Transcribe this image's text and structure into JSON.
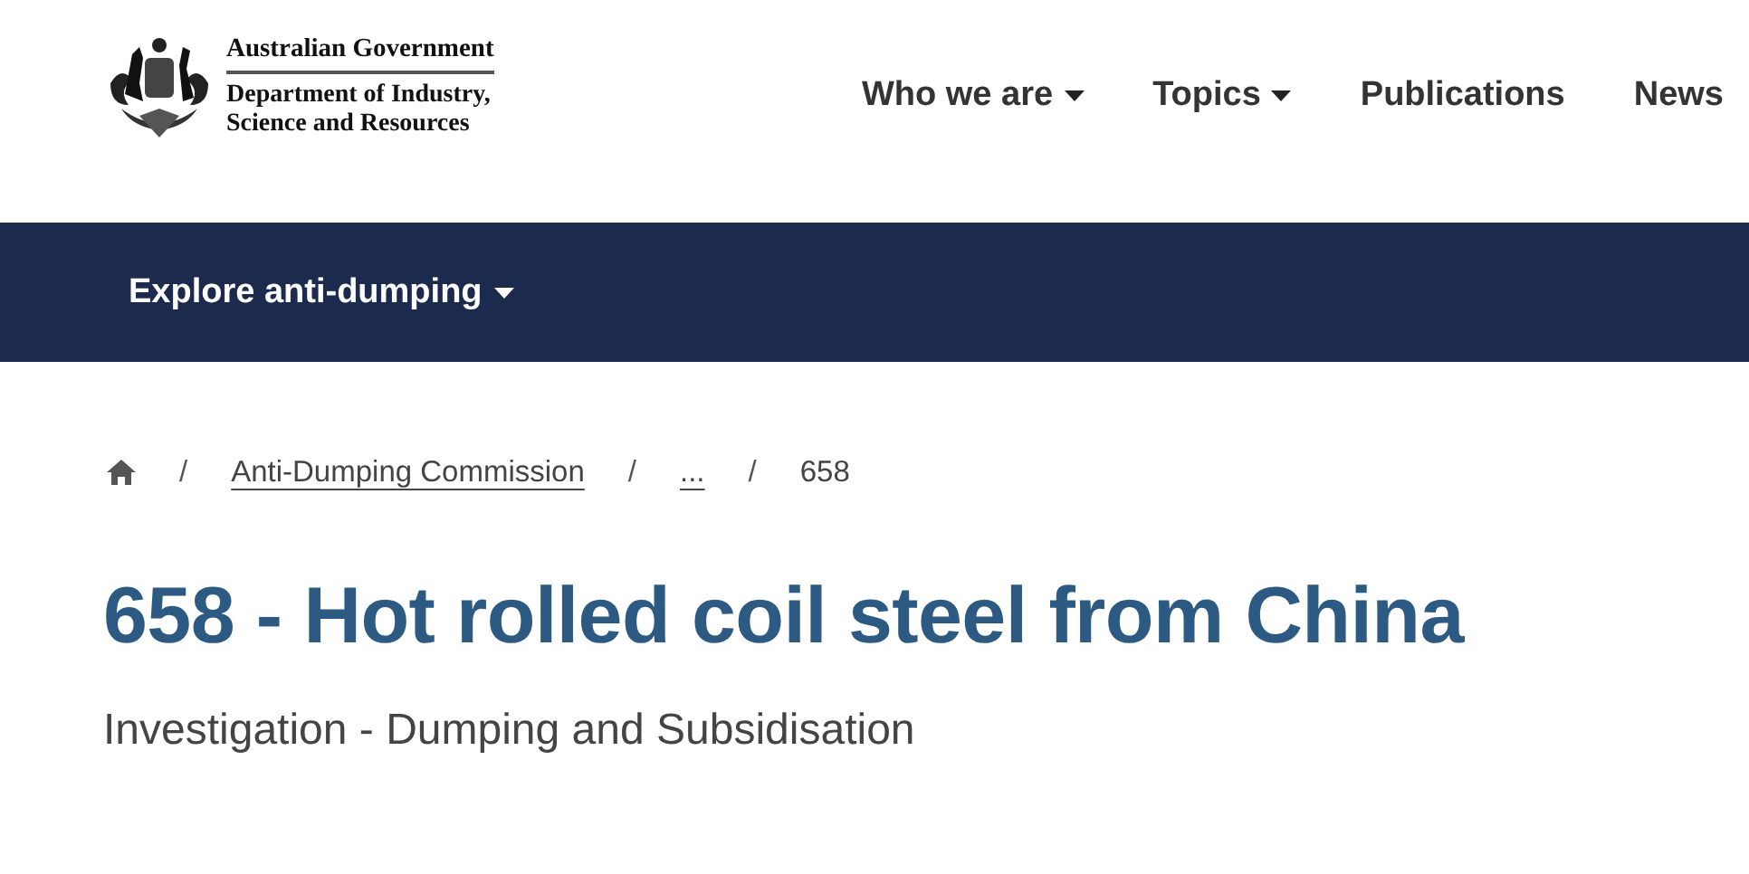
{
  "header": {
    "logo": {
      "line_1": "Australian Government",
      "line_2": "Department of Industry,",
      "line_3": "Science and Resources"
    },
    "nav": [
      {
        "label": "Who we are",
        "has_menu": true
      },
      {
        "label": "Topics",
        "has_menu": true
      },
      {
        "label": "Publications",
        "has_menu": false
      },
      {
        "label": "News",
        "has_menu": false
      }
    ]
  },
  "subnav": {
    "label": "Explore anti-dumping",
    "has_menu": true
  },
  "breadcrumb": [
    {
      "kind": "home"
    },
    {
      "kind": "link",
      "separator": "/",
      "label": "Anti-Dumping Commission"
    },
    {
      "kind": "link",
      "separator": "/",
      "label": "..."
    },
    {
      "kind": "current",
      "separator": "/",
      "label": "658"
    }
  ],
  "title": "658 - Hot rolled coil steel from China",
  "subtitle": "Investigation - Dumping and Subsidisation"
}
